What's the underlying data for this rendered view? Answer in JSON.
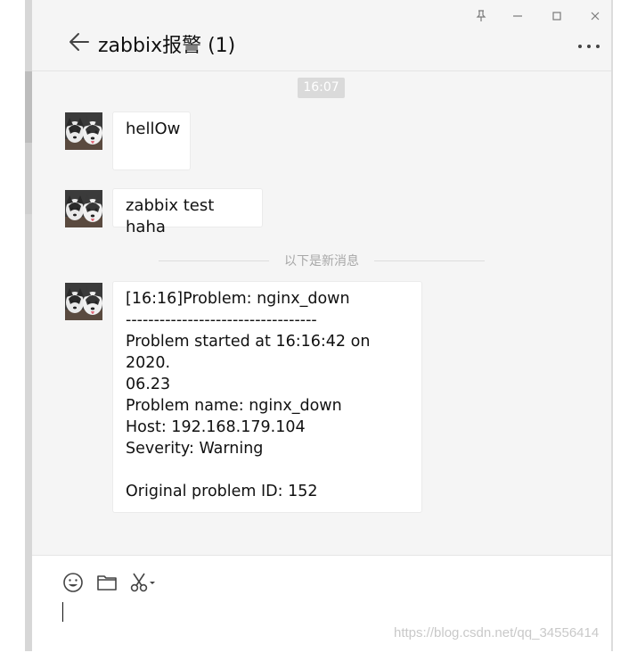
{
  "chat": {
    "title": "zabbix报警 (1)"
  },
  "window_controls": {
    "pin": "pin-icon",
    "minimize": "minimize-icon",
    "maximize": "maximize-icon",
    "close": "close-icon"
  },
  "timestamp": "16:07",
  "divider_text": "以下是新消息",
  "messages": [
    {
      "text": "hellOw"
    },
    {
      "text": "zabbix test haha"
    },
    {
      "text": "[16:16]Problem: nginx_down\n----------------------------------\nProblem started at 16:16:42 on 2020.\n06.23\nProblem name: nginx_down\nHost: 192.168.179.104\nSeverity: Warning\n\nOriginal problem ID: 152"
    }
  ],
  "composer": {
    "tools": [
      "emoji-icon",
      "folder-icon",
      "scissors-icon"
    ]
  },
  "watermark": "https://blog.csdn.net/qq_34556414"
}
